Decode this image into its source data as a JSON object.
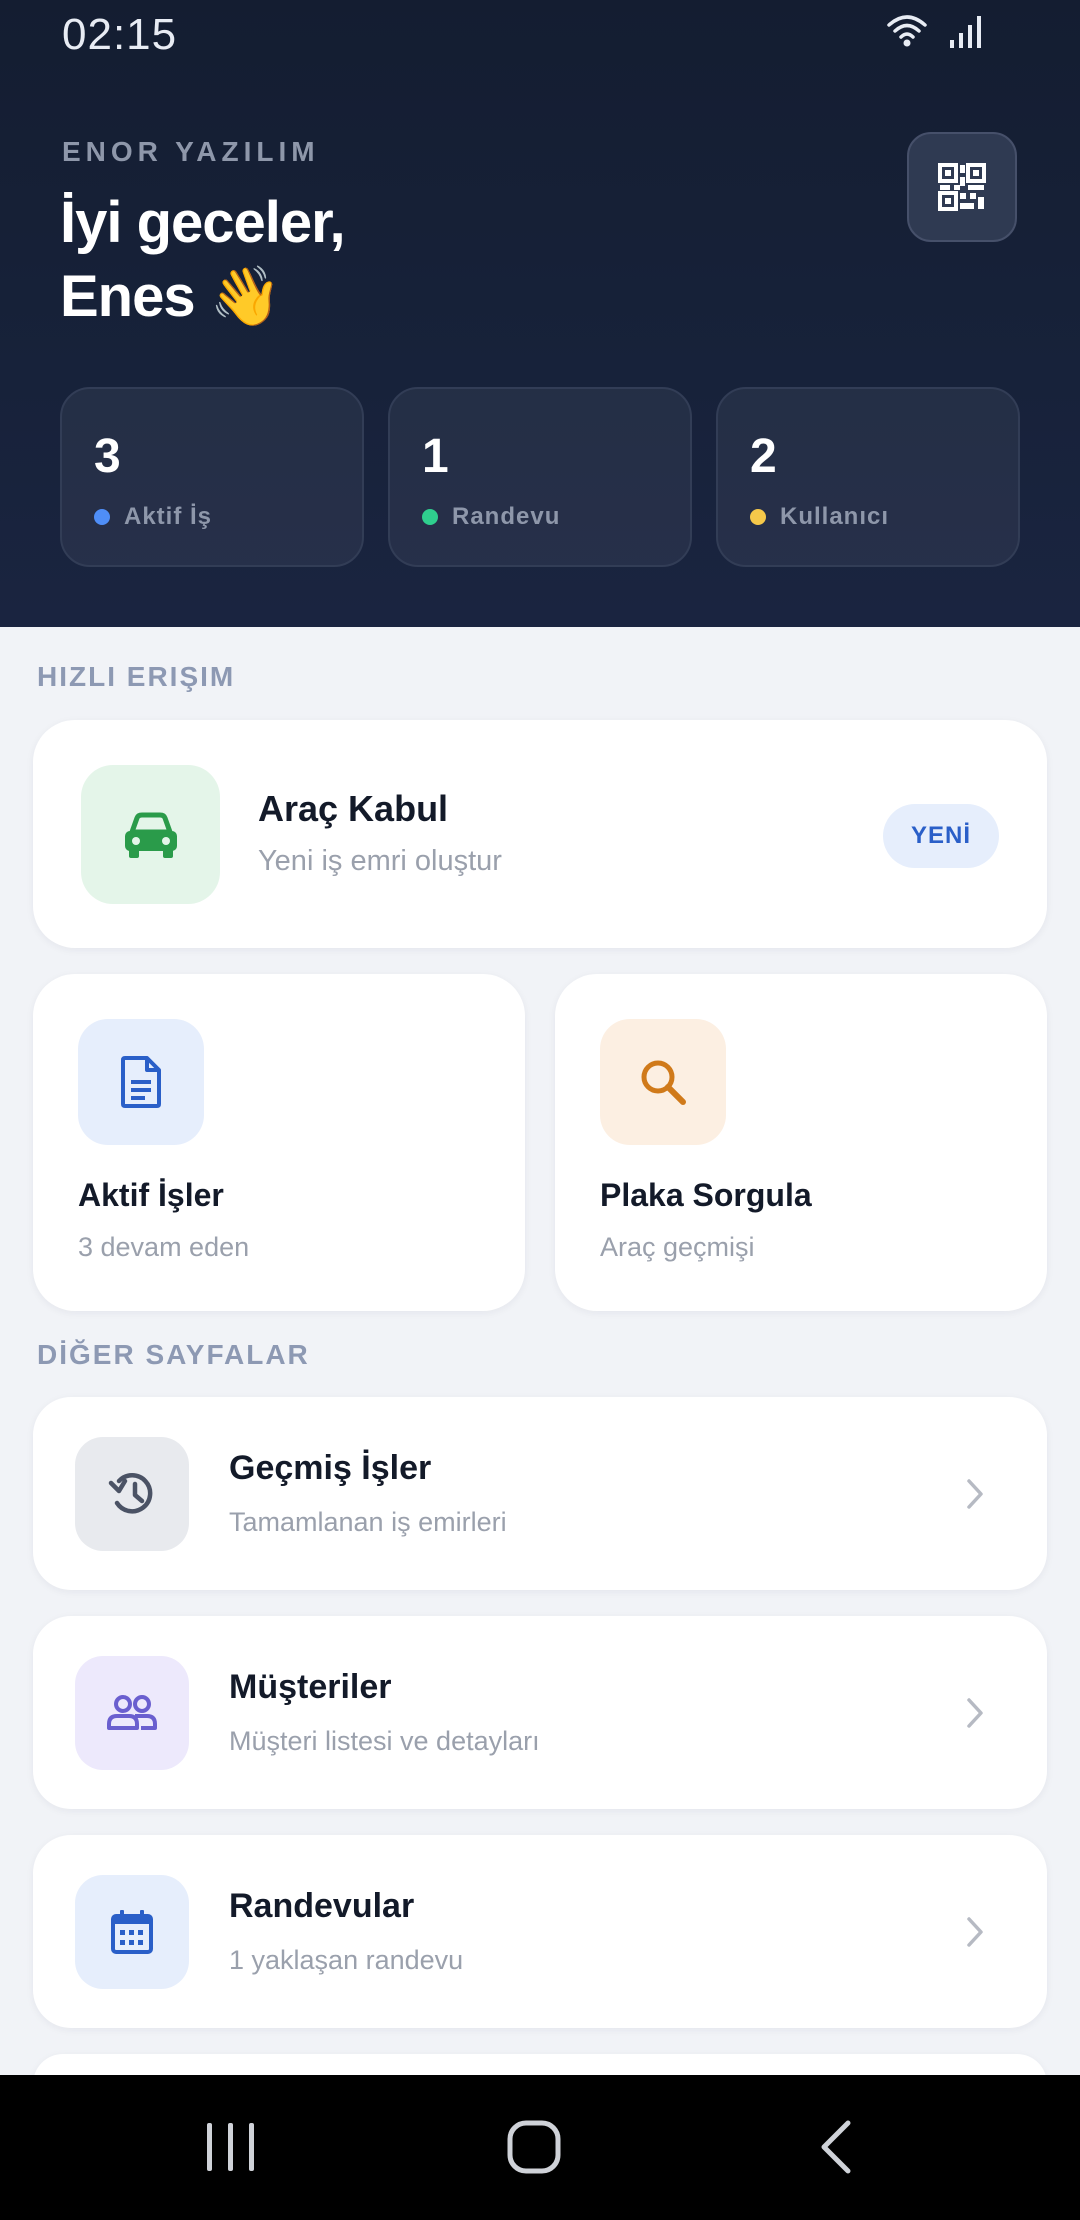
{
  "status_bar": {
    "time": "02:15"
  },
  "header": {
    "brand": "ENOR YAZILIM",
    "greeting_line1": "İyi geceler,",
    "greeting_line2": "Enes 👋"
  },
  "stats": [
    {
      "value": "3",
      "label": "Aktif İş",
      "color": "#4f8ef7"
    },
    {
      "value": "1",
      "label": "Randevu",
      "color": "#2fcf8e"
    },
    {
      "value": "2",
      "label": "Kullanıcı",
      "color": "#f5c84a"
    }
  ],
  "quick_access": {
    "title": "HIZLI ERIŞIM",
    "vehicle_intake": {
      "title": "Araç Kabul",
      "subtitle": "Yeni iş emri oluştur",
      "badge": "YENİ"
    },
    "active_jobs": {
      "title": "Aktif İşler",
      "subtitle": "3 devam eden"
    },
    "plate_query": {
      "title": "Plaka Sorgula",
      "subtitle": "Araç geçmişi"
    }
  },
  "other_pages": {
    "title": "DİĞER SAYFALAR",
    "items": [
      {
        "title": "Geçmiş İşler",
        "subtitle": "Tamamlanan iş emirleri"
      },
      {
        "title": "Müşteriler",
        "subtitle": "Müşteri listesi ve detayları"
      },
      {
        "title": "Randevular",
        "subtitle": "1 yaklaşan randevu"
      }
    ]
  }
}
